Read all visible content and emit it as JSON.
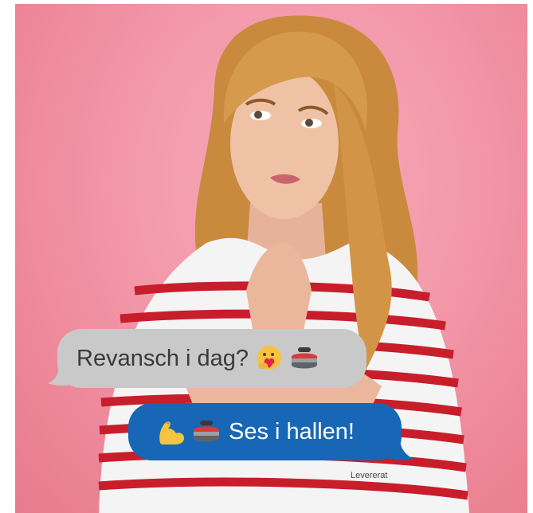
{
  "messages": {
    "received": {
      "text": "Revansch i dag?",
      "emojis": [
        "hugging-face-with-heart-icon",
        "curling-stone-icon"
      ]
    },
    "sent": {
      "text": "Ses i hallen!",
      "emojis": [
        "flexed-biceps-icon",
        "curling-stone-icon"
      ],
      "status": "Levererat"
    }
  },
  "colors": {
    "background": "#f39aab",
    "received_bubble": "#c9c9c9",
    "sent_bubble": "#1767b6"
  }
}
